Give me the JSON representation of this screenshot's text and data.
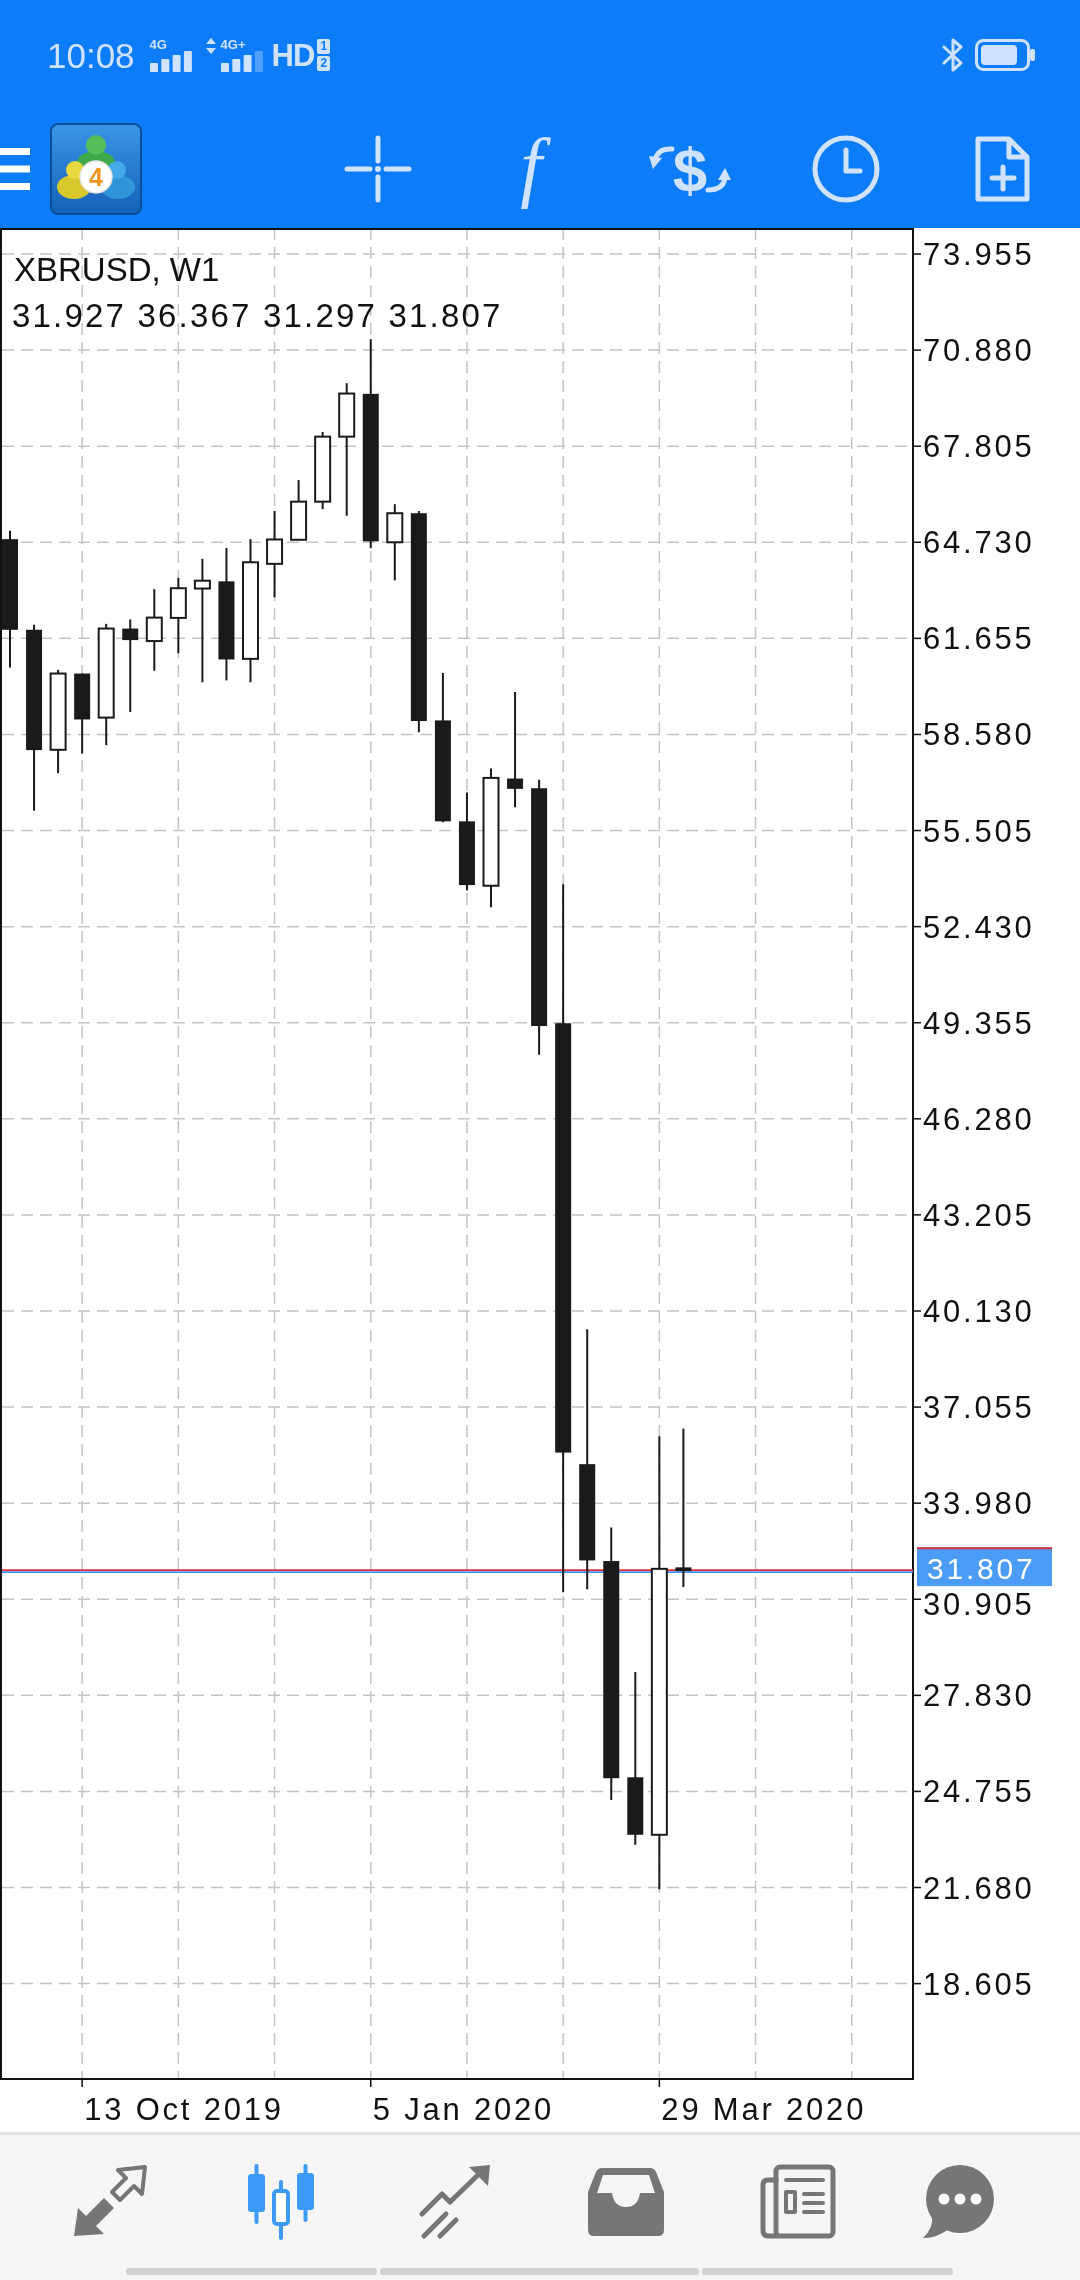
{
  "status_bar": {
    "time": "10:08",
    "networks": [
      {
        "type": "4G"
      },
      {
        "type": "4G+"
      }
    ],
    "hd": "HD",
    "hd_slots": [
      "1",
      "2"
    ]
  },
  "toolbar": {
    "logo_badge": "4",
    "function_symbol": "f",
    "currency_symbol": "$"
  },
  "chart": {
    "title": "XBRUSD, W1",
    "ohlc": "31.927 36.367 31.297 31.807",
    "price_labels": [
      "73.955",
      "70.880",
      "67.805",
      "64.730",
      "61.655",
      "58.580",
      "55.505",
      "52.430",
      "49.355",
      "46.280",
      "43.205",
      "40.130",
      "37.055",
      "33.980",
      "30.905",
      "27.830",
      "24.755",
      "21.680",
      "18.605"
    ],
    "current_price": "31.807",
    "date_labels": [
      "13 Oct 2019",
      "5 Jan 2020",
      "29 Mar 2020"
    ]
  },
  "bottom_nav": [
    {
      "kind": "arrows",
      "selected": false
    },
    {
      "kind": "candles",
      "selected": true
    },
    {
      "kind": "trendline",
      "selected": false
    },
    {
      "kind": "tray",
      "selected": false
    },
    {
      "kind": "newspaper",
      "selected": false
    },
    {
      "kind": "bubble",
      "selected": false
    }
  ]
}
